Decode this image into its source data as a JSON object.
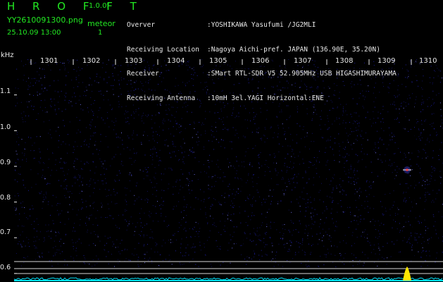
{
  "header": {
    "logo": "H R O F F T",
    "version": "1.0.0f",
    "filename": "YY2610091300.png",
    "datetime": "25.10.09 13:00",
    "meteor_label": "meteor",
    "meteor_count": "1"
  },
  "info": [
    {
      "key": "Overver",
      "value": ":YOSHIKAWA Yasufumi /JG2MLI"
    },
    {
      "key": "Receiving Location",
      "value": ":Nagoya Aichi-pref. JAPAN (136.90E, 35.20N)"
    },
    {
      "key": "Receiver",
      "value": ":SMart RTL-SDR V5 52.905MHz USB HIGASHIMURAYAMA"
    },
    {
      "key": "Receiving Antenna",
      "value": ":10mH 3el.YAGI Horizontal:ENE"
    }
  ],
  "axis": {
    "y_unit": "kHz",
    "y_ticks": [
      "1.1",
      "1.0",
      "0.9",
      "0.8",
      "0.7",
      "0.6"
    ],
    "y_values": [
      1.1,
      1.0,
      0.9,
      0.8,
      0.7,
      0.6
    ],
    "x_ticks": [
      "1301",
      "1302",
      "1303",
      "1304",
      "1305",
      "1306",
      "1307",
      "1308",
      "1309",
      "1310"
    ],
    "y_range": [
      0.58,
      1.2
    ]
  },
  "colors": {
    "background": "#000000",
    "header_green": "#22e822",
    "noise": "#1d1d9a",
    "spectrum": "#00e6ff",
    "detection": "#ff4040",
    "spectrum_peak": "#ffe600"
  },
  "chart_data": {
    "type": "heatmap",
    "x_unit": "minute",
    "y_unit": "kHz",
    "y_range": [
      0.58,
      1.2
    ],
    "detections": [
      {
        "minute": 1309.9,
        "freq_khz": 0.89,
        "label": "meteor"
      }
    ],
    "spectrum_peak_khz": 0.89
  }
}
